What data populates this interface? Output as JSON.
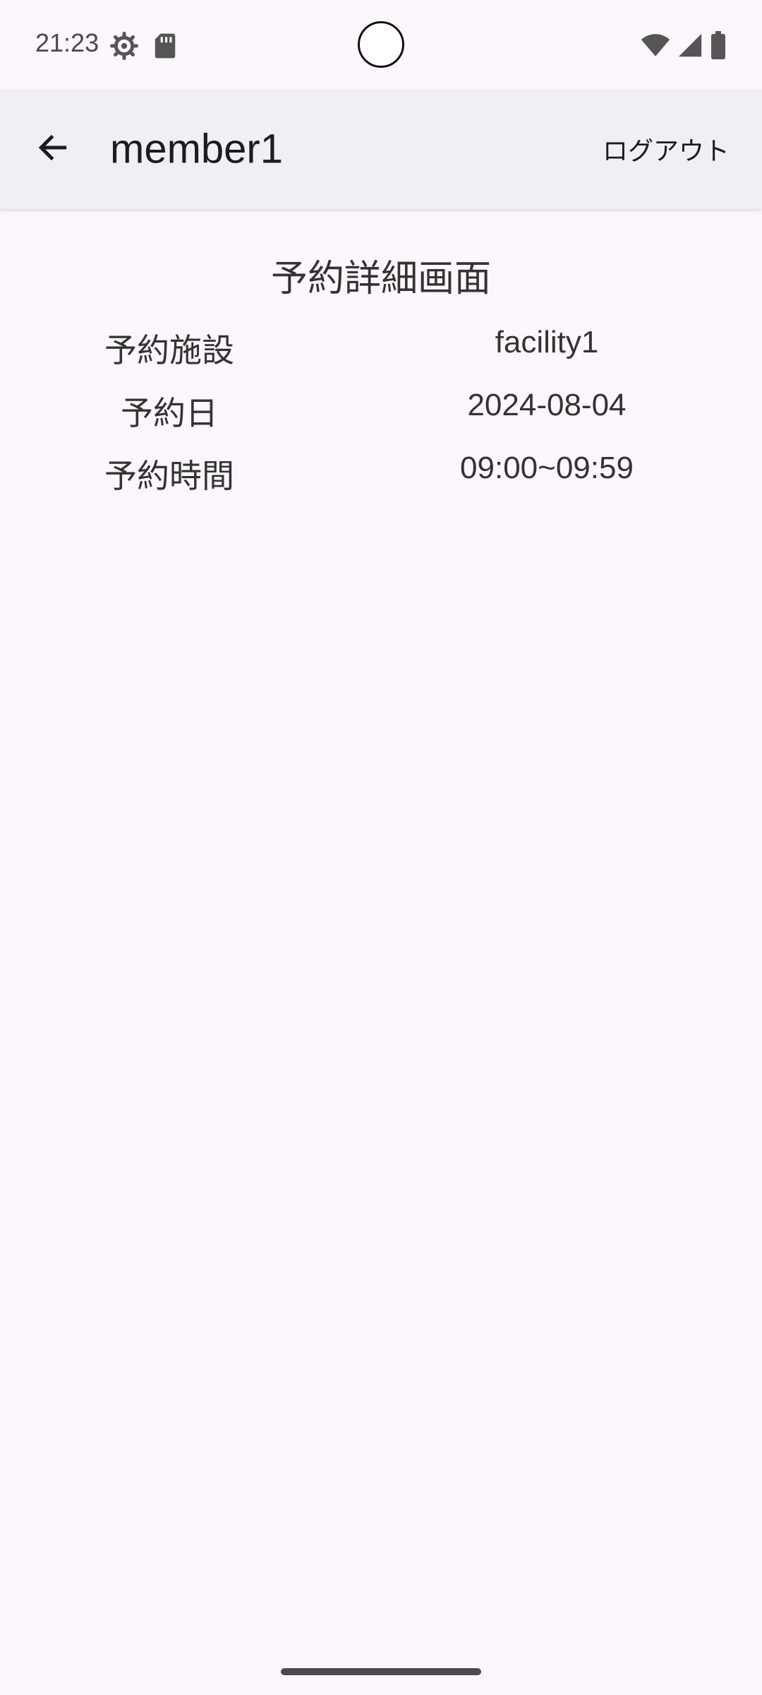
{
  "status_bar": {
    "time": "21:23",
    "left_icons": [
      "settings-gear-icon",
      "sd-card-icon"
    ],
    "right_icons": [
      "wifi-icon",
      "cellular-signal-icon",
      "battery-icon"
    ]
  },
  "app_bar": {
    "back_icon": "arrow-back-icon",
    "title": "member1",
    "logout_label": "ログアウト"
  },
  "page": {
    "title": "予約詳細画面",
    "details": [
      {
        "label": "予約施設",
        "value": "facility1"
      },
      {
        "label": "予約日",
        "value": "2024-08-04"
      },
      {
        "label": "予約時間",
        "value": "09:00~09:59"
      }
    ]
  },
  "colors": {
    "background": "#fdf7fd",
    "app_bar": "#f2eef6",
    "text": "#1d1b20"
  }
}
